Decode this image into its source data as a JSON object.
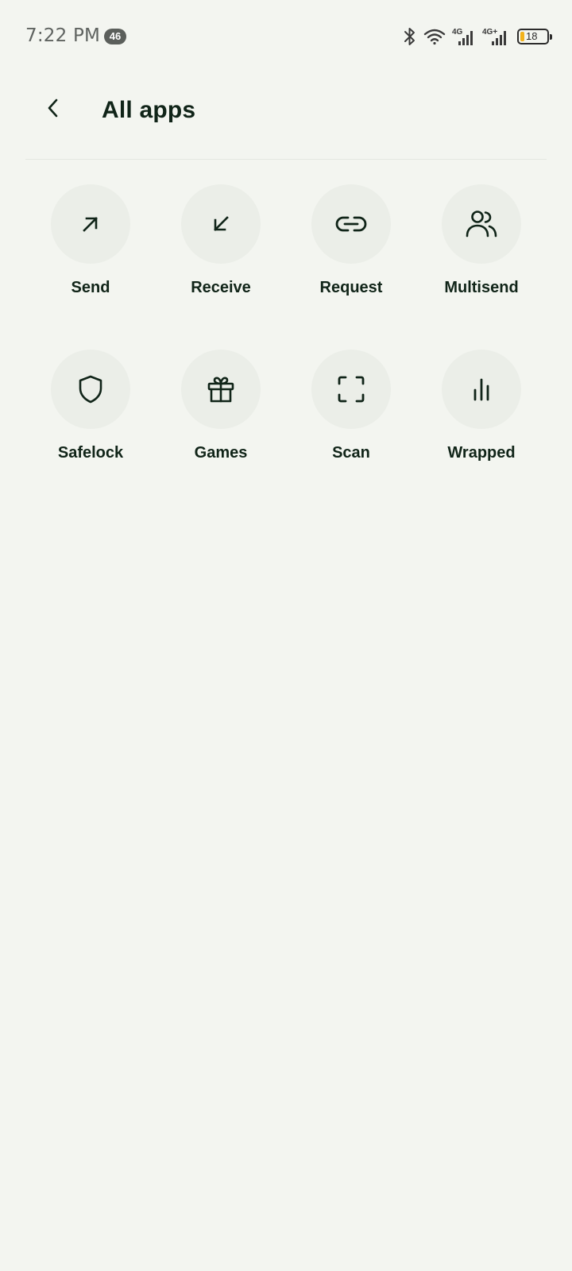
{
  "status_bar": {
    "time": "7:22 PM",
    "notification_count": "46",
    "network_1": "4G",
    "network_2": "4G+",
    "battery_level": "18",
    "battery_color": "#f2b21b"
  },
  "header": {
    "title": "All apps",
    "back_icon": "chevron-left-icon"
  },
  "apps": [
    {
      "label": "Send",
      "icon": "arrow-up-right-icon"
    },
    {
      "label": "Receive",
      "icon": "arrow-down-left-icon"
    },
    {
      "label": "Request",
      "icon": "link-icon"
    },
    {
      "label": "Multisend",
      "icon": "users-icon"
    },
    {
      "label": "Safelock",
      "icon": "shield-icon"
    },
    {
      "label": "Games",
      "icon": "gift-icon"
    },
    {
      "label": "Scan",
      "icon": "scan-frame-icon"
    },
    {
      "label": "Wrapped",
      "icon": "bar-chart-icon"
    }
  ],
  "colors": {
    "background": "#f3f5f0",
    "tile_background": "#ebeee8",
    "text": "#102418"
  }
}
